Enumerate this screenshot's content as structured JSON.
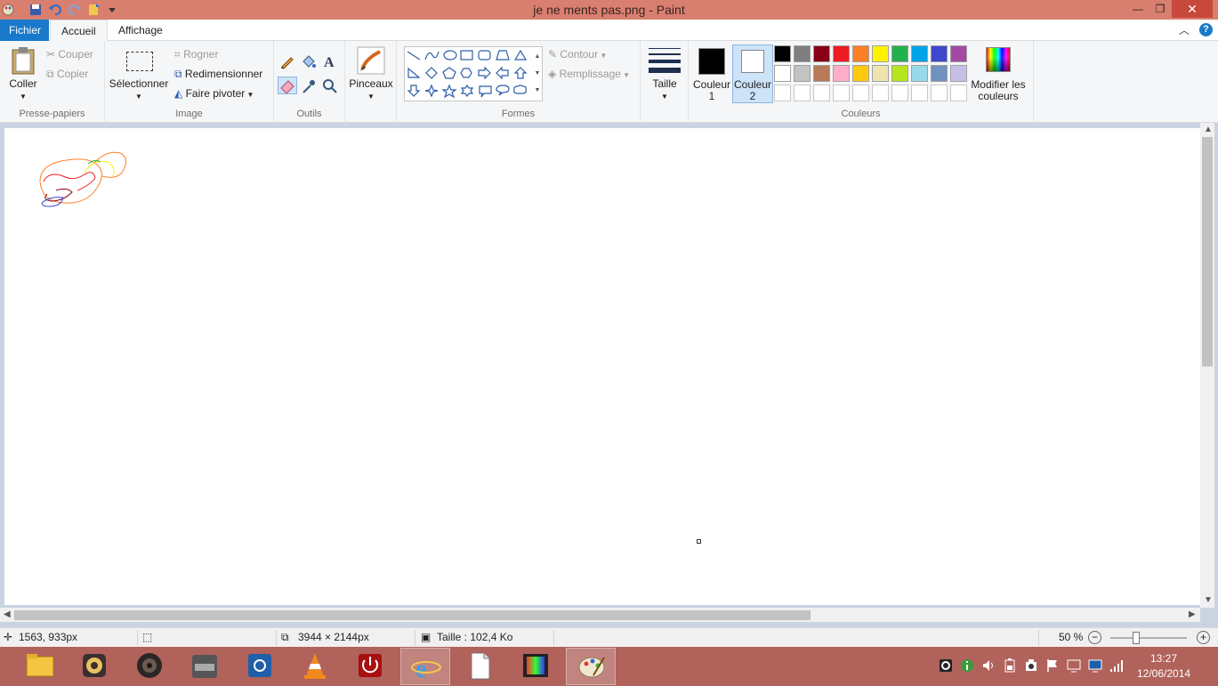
{
  "window": {
    "title": "je ne ments pas.png - Paint"
  },
  "tabs": [
    {
      "label": "Fichier"
    },
    {
      "label": "Accueil"
    },
    {
      "label": "Affichage"
    }
  ],
  "ribbon": {
    "clipboard": {
      "paste": "Coller",
      "cut": "Couper",
      "copy": "Copier",
      "group": "Presse-papiers"
    },
    "image": {
      "select": "Sélectionner",
      "crop": "Rogner",
      "resize": "Redimensionner",
      "rotate": "Faire pivoter",
      "group": "Image"
    },
    "tools": {
      "group": "Outils"
    },
    "brushes": {
      "label": "Pinceaux"
    },
    "shapes": {
      "outline": "Contour",
      "fill": "Remplissage",
      "group": "Formes"
    },
    "size": {
      "label": "Taille"
    },
    "colors": {
      "color1_line1": "Couleur",
      "color1_line2": "1",
      "color2_line1": "Couleur",
      "color2_line2": "2",
      "color1": "#000000",
      "color2": "#ffffff",
      "edit_line1": "Modifier les",
      "edit_line2": "couleurs",
      "group": "Couleurs",
      "palette_row1": [
        "#000000",
        "#7f7f7f",
        "#880015",
        "#ed1c24",
        "#ff7f27",
        "#fff200",
        "#22b14c",
        "#00a2e8",
        "#3f48cc",
        "#a349a4"
      ],
      "palette_row2": [
        "#ffffff",
        "#c3c3c3",
        "#b97a57",
        "#ffaec9",
        "#ffc90e",
        "#efe4b0",
        "#b5e61d",
        "#99d9ea",
        "#7092be",
        "#c8bfe7"
      ]
    }
  },
  "status": {
    "cursor_pos": "1563, 933px",
    "image_size": "3944 × 2144px",
    "file_size": "Taille : 102,4 Ko",
    "zoom": "50 %",
    "zoom_fraction": 0.5
  },
  "taskbar": {
    "time": "13:27",
    "date": "12/06/2014"
  }
}
